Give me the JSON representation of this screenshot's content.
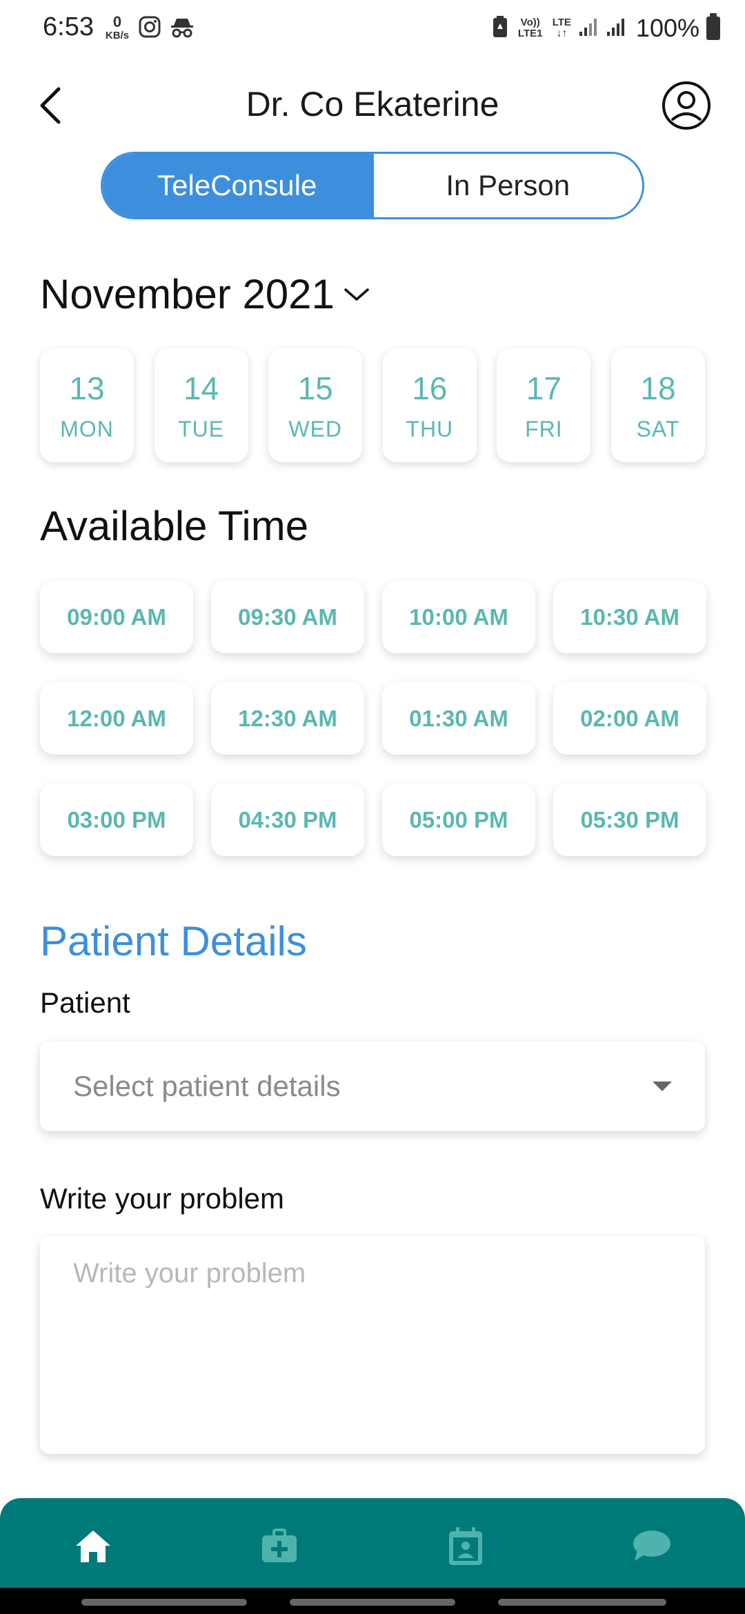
{
  "status_bar": {
    "time": "6:53",
    "net_speed_value": "0",
    "net_speed_unit": "KB/s",
    "volte_label": "Vo)) LTE1",
    "lte_label": "LTE",
    "battery_percent": "100%"
  },
  "header": {
    "title": "Dr. Co Ekaterine"
  },
  "consult_toggle": {
    "options": [
      "TeleConsule",
      "In Person"
    ],
    "selected": "TeleConsule"
  },
  "calendar": {
    "month_label": "November 2021",
    "dates": [
      {
        "num": "13",
        "day": "MON"
      },
      {
        "num": "14",
        "day": "TUE"
      },
      {
        "num": "15",
        "day": "WED"
      },
      {
        "num": "16",
        "day": "THU"
      },
      {
        "num": "17",
        "day": "FRI"
      },
      {
        "num": "18",
        "day": "SAT"
      }
    ]
  },
  "available_time": {
    "title": "Available Time",
    "slots": [
      "09:00 AM",
      "09:30 AM",
      "10:00 AM",
      "10:30 AM",
      "12:00 AM",
      "12:30 AM",
      "01:30 AM",
      "02:00 AM",
      "03:00 PM",
      "04:30 PM",
      "05:00 PM",
      "05:30 PM"
    ]
  },
  "patient_details": {
    "heading": "Patient Details",
    "patient_label": "Patient",
    "patient_select_value": "Select patient details",
    "problem_label": "Write your problem",
    "problem_placeholder": "Write your problem"
  },
  "bottom_nav": {
    "items": [
      "home-icon",
      "medical-kit-icon",
      "calendar-contact-icon",
      "chat-bubble-icon"
    ]
  },
  "colors": {
    "primary_blue": "#3d8fde",
    "teal_text": "#5ab8b0",
    "nav_teal": "#007a78"
  }
}
